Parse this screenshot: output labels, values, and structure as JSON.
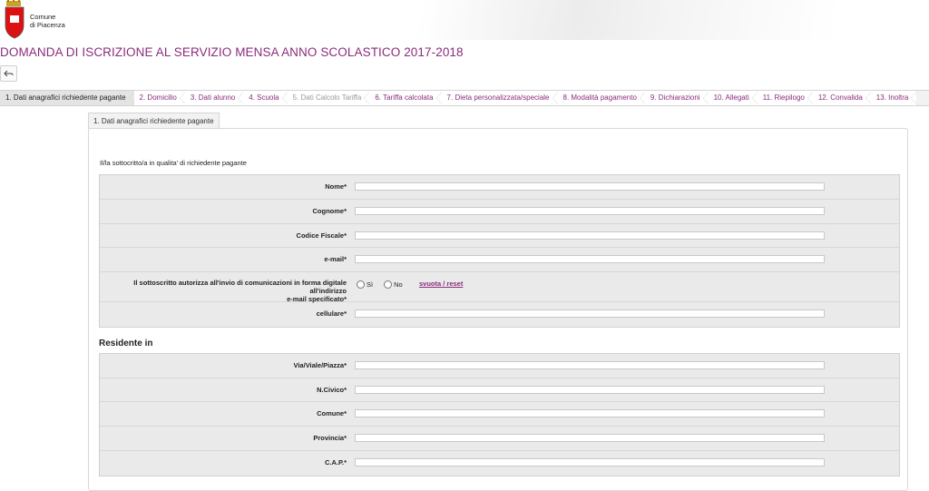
{
  "header": {
    "logo_line1": "Comune",
    "logo_line2": "di Piacenza"
  },
  "page_title": "DOMANDA DI ISCRIZIONE AL SERVIZIO MENSA ANNO SCOLASTICO 2017-2018",
  "back_icon": "back-arrow-icon",
  "tabs": [
    {
      "label": "1. Dati anagrafici richiedente pagante",
      "state": "active"
    },
    {
      "label": "2. Domicilio",
      "state": "enabled"
    },
    {
      "label": "3. Dati alunno",
      "state": "enabled"
    },
    {
      "label": "4. Scuola",
      "state": "enabled"
    },
    {
      "label": "5. Dati Calcolo Tariffa",
      "state": "disabled"
    },
    {
      "label": "6. Tariffa calcolata",
      "state": "enabled"
    },
    {
      "label": "7. Dieta personalizzata/speciale",
      "state": "enabled"
    },
    {
      "label": "8. Modalità pagamento",
      "state": "enabled"
    },
    {
      "label": "9. Dichiarazioni",
      "state": "enabled"
    },
    {
      "label": "10. Allegati",
      "state": "enabled"
    },
    {
      "label": "11. Riepilogo",
      "state": "enabled"
    },
    {
      "label": "12. Convalida",
      "state": "enabled"
    },
    {
      "label": "13. Inoltra",
      "state": "enabled"
    }
  ],
  "subtab": "1. Dati anagrafici richiedente pagante",
  "form": {
    "intro": "Il/la sottocritto/a in qualita' di richiedente pagante",
    "nome_label": "Nome*",
    "cognome_label": "Cognome*",
    "cf_label": "Codice Fiscale*",
    "email_label": "e-mail*",
    "consent_label_1": "Il sottoscritto autorizza all'invio di comunicazioni in forma digitale all'indirizzo",
    "consent_label_2": "e-mail specificato*",
    "consent_yes": "Sì",
    "consent_no": "No",
    "reset_link": "svuota / reset",
    "cellulare_label": "cellulare*",
    "residence_title": "Residente in",
    "via_label": "Via/Viale/Piazza*",
    "civico_label": "N.Civico*",
    "comune_label": "Comune*",
    "provincia_label": "Provincia*",
    "cap_label": "C.A.P.*"
  },
  "colors": {
    "accent": "#8a2c7c",
    "section_bg": "#eaeaea",
    "tab_active_bg": "#e4e4e4"
  }
}
